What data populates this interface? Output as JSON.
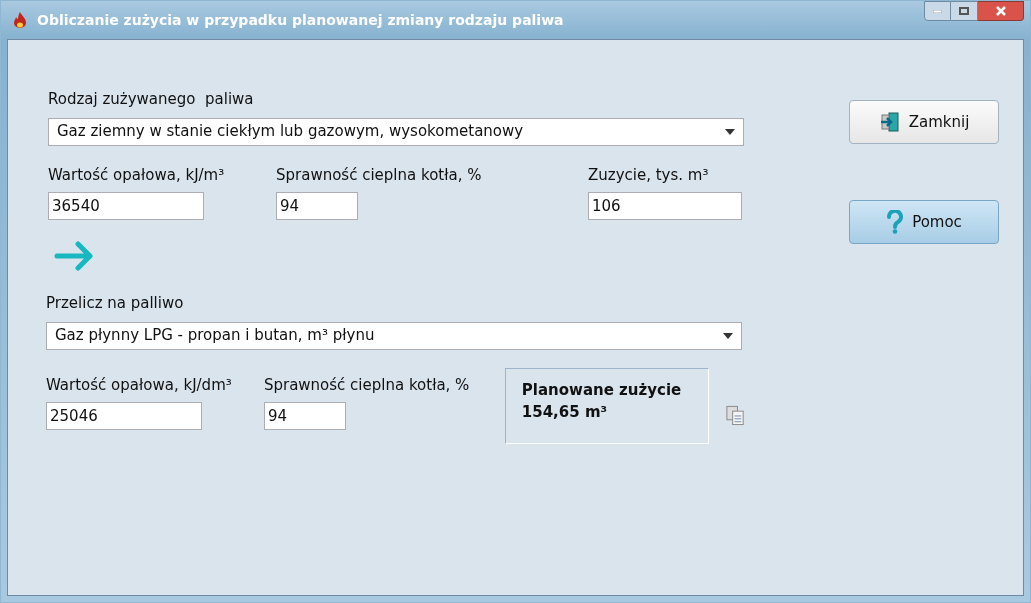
{
  "window": {
    "title": "Obliczanie zużycia w przypadku planowanej zmiany rodzaju paliwa"
  },
  "source": {
    "label": "Rodzaj zużywanego  paliwa",
    "fuel": "Gaz ziemny w stanie ciekłym lub gazowym, wysokometanowy",
    "fields": [
      {
        "label": "Wartość opałowa, kJ/m³",
        "value": "36540"
      },
      {
        "label": "Sprawność cieplna kotła, %",
        "value": "94"
      },
      {
        "label": "Zuzycie, tys. m³",
        "value": "106"
      }
    ]
  },
  "target": {
    "label": "Przelicz na palliwo",
    "fuel": "Gaz płynny LPG - propan i butan, m³ płynu",
    "fields": [
      {
        "label": "Wartość opałowa, kJ/dm³",
        "value": "25046"
      },
      {
        "label": "Sprawność cieplna kotła, %",
        "value": "94"
      }
    ]
  },
  "result": {
    "title": "Planowane zużycie",
    "value": "154,65 m³"
  },
  "buttons": [
    {
      "kind": "close",
      "label": "Zamknij",
      "focused": false
    },
    {
      "kind": "help",
      "label": "Pomoc",
      "focused": true
    }
  ]
}
